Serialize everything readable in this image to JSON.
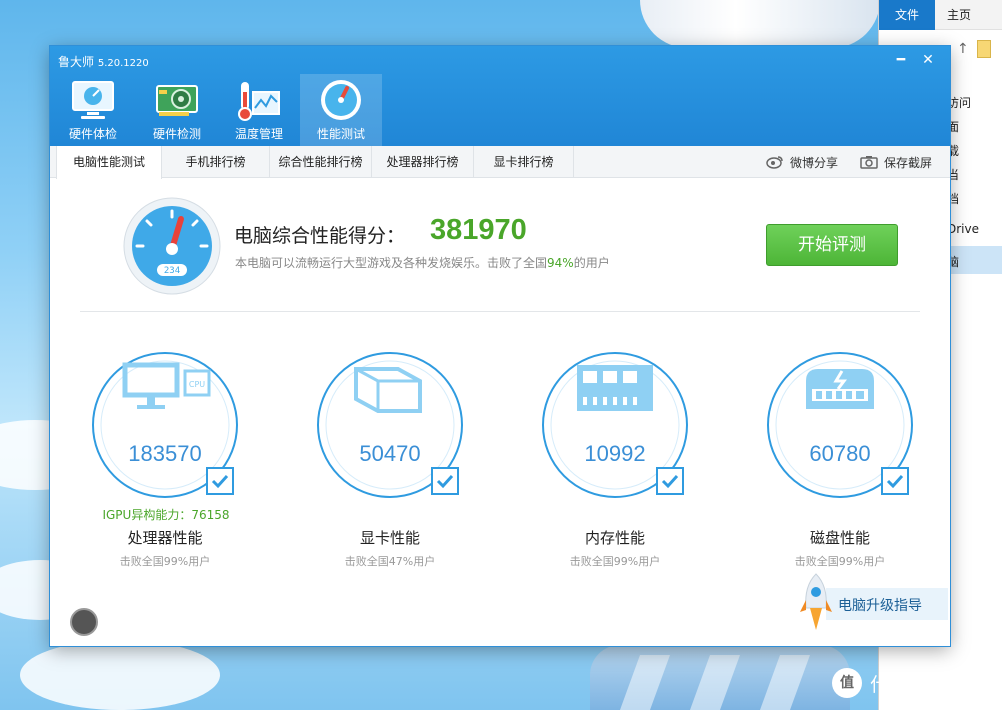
{
  "explorer": {
    "ribbon_tabs": [
      "文件",
      "主页"
    ],
    "nav_labels": [
      "访问",
      "面",
      "载",
      "当",
      "档",
      "Drive",
      "脑"
    ]
  },
  "app": {
    "title": "鲁大师",
    "version": "5.20.1220",
    "window_controls": {
      "minimize": "━",
      "close": "✕"
    },
    "main_tabs": [
      {
        "label": "硬件体检",
        "icon": "monitor-icon"
      },
      {
        "label": "硬件检测",
        "icon": "graphics-card-icon"
      },
      {
        "label": "温度管理",
        "icon": "thermometer-icon"
      },
      {
        "label": "性能测试",
        "icon": "speedometer-icon",
        "active": true
      }
    ],
    "sub_tabs": [
      "电脑性能测试",
      "手机排行榜",
      "综合性能排行榜",
      "处理器排行榜",
      "显卡排行榜"
    ],
    "sub_actions": [
      {
        "label": "微博分享",
        "icon": "weibo-icon"
      },
      {
        "label": "保存截屏",
        "icon": "camera-icon"
      }
    ],
    "score": {
      "label": "电脑综合性能得分：",
      "value": "381970",
      "desc_prefix": "本电脑可以流畅运行大型游戏及各种发烧娱乐。击败了全国",
      "desc_pct": "94%",
      "desc_suffix": "的用户",
      "gauge_text": "234"
    },
    "start_button": "开始评测",
    "metrics": [
      {
        "value": "183570",
        "name": "处理器性能",
        "sub": "击败全国99%用户",
        "extra": "IGPU异构能力：76158",
        "icon": "cpu-icon"
      },
      {
        "value": "50470",
        "name": "显卡性能",
        "sub": "击败全国47%用户",
        "extra": "",
        "icon": "graphics-cube-icon"
      },
      {
        "value": "10992",
        "name": "内存性能",
        "sub": "击败全国99%用户",
        "extra": "",
        "icon": "memory-chip-icon"
      },
      {
        "value": "60780",
        "name": "磁盘性能",
        "sub": "击败全国99%用户",
        "extra": "",
        "icon": "disk-drive-icon"
      }
    ],
    "upgrade_label": "电脑升级指导"
  },
  "watermark": {
    "badge": "值",
    "text": "什么值得买"
  },
  "colors": {
    "primary": "#2086d6",
    "green": "#4aa62a",
    "ring": "#2f9be0"
  }
}
